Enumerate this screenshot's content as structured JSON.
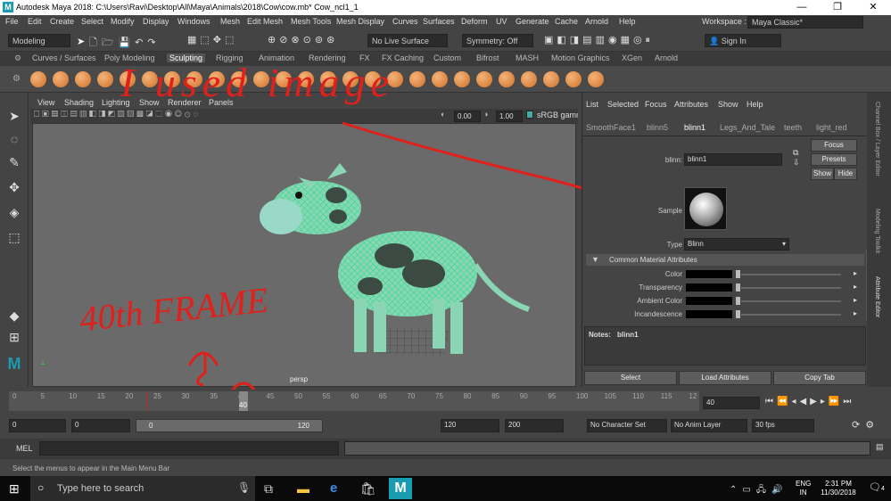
{
  "window": {
    "title": "Autodesk Maya 2018: C:\\Users\\Ravi\\Desktop\\All\\Maya\\Animals\\2018\\Cow\\cow.mb*    Cow_ncl1_1",
    "icon": "M",
    "minimize": "—",
    "restore": "❐",
    "close": "✕"
  },
  "menubar": [
    "File",
    "Edit",
    "Create",
    "Select",
    "Modify",
    "Display",
    "Windows",
    "Mesh",
    "Edit Mesh",
    "Mesh Tools",
    "Mesh Display",
    "Curves",
    "Surfaces",
    "Deform",
    "UV",
    "Generate",
    "Cache",
    "Arnold",
    "Help"
  ],
  "workspace": {
    "label": "Workspace :",
    "value": "Maya Classic*"
  },
  "statusline": {
    "menuset": "Modeling",
    "live_surface": "No Live Surface",
    "symmetry": "Symmetry: Off",
    "sign_in": "Sign In"
  },
  "shelf_tabs": [
    "Curves / Surfaces",
    "Poly Modeling",
    "Sculpting",
    "Rigging",
    "Animation",
    "Rendering",
    "FX",
    "FX Caching",
    "Custom",
    "Bifrost",
    "MASH",
    "Motion Graphics",
    "XGen",
    "Arnold"
  ],
  "active_shelf": "Sculpting",
  "panel_menu": [
    "View",
    "Shading",
    "Lighting",
    "Show",
    "Renderer",
    "Panels"
  ],
  "panel_toolbar": {
    "exposure": "0.00",
    "gamma": "1.00",
    "colorspace": "sRGB gamma"
  },
  "viewport": {
    "camera": "persp"
  },
  "annotations": {
    "top": "I used image",
    "left": "40th FRAME",
    "color": "#e0201b"
  },
  "attribute_editor": {
    "menu": [
      "List",
      "Selected",
      "Focus",
      "Attributes",
      "Show",
      "Help"
    ],
    "tabs": [
      "SmoothFace1",
      "blinn5",
      "blinn1",
      "Legs_And_Tale",
      "teeth",
      "light_red"
    ],
    "active_tab": "blinn1",
    "node_label": "blinn:",
    "node_name": "blinn1",
    "focus_button": "Focus",
    "presets_button": "Presets",
    "show_button": "Show",
    "hide_button": "Hide",
    "sample_label": "Sample",
    "type_label": "Type",
    "type_value": "Blinn",
    "section_title": "Common Material Attributes",
    "attributes": [
      "Color",
      "Transparency",
      "Ambient Color",
      "Incandescence"
    ],
    "notes_label": "Notes:",
    "notes_value": "blinn1",
    "buttons": [
      "Select",
      "Load Attributes",
      "Copy Tab"
    ]
  },
  "side_tabs": [
    "Channel Box / Layer Editor",
    "Modeling Toolkit",
    "Attribute Editor"
  ],
  "timeline": {
    "ticks": [
      "0",
      "5",
      "10",
      "15",
      "20",
      "25",
      "30",
      "35",
      "40",
      "45",
      "50",
      "55",
      "60",
      "65",
      "70",
      "75",
      "80",
      "85",
      "90",
      "95",
      "100",
      "105",
      "110",
      "115",
      "12"
    ],
    "current_frame": "40",
    "current_field": "40"
  },
  "range": {
    "start": "0",
    "start_inner": "0",
    "slider_start": "0",
    "slider_end": "120",
    "end_inner": "120",
    "end": "200",
    "character_set": "No Character Set",
    "anim_layer": "No Anim Layer",
    "fps": "30 fps"
  },
  "mel": {
    "label": "MEL"
  },
  "help_line": "Select the menus to appear in the Main Menu Bar",
  "taskbar": {
    "search_placeholder": "Type here to search",
    "lang1": "ENG",
    "lang2": "IN",
    "time": "2:31 PM",
    "date": "11/30/2018",
    "notifications": "4"
  }
}
